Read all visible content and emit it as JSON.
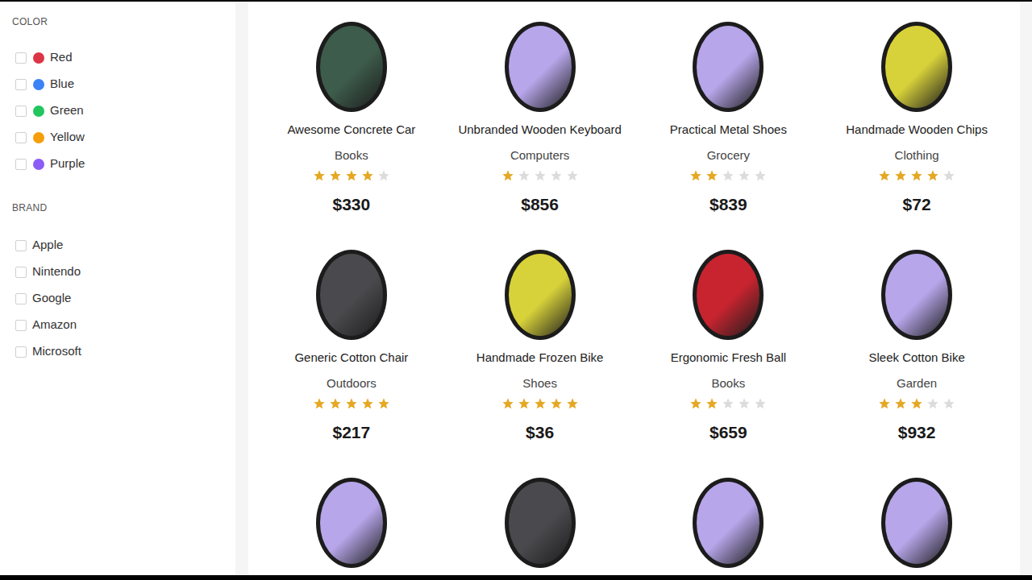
{
  "sidebar": {
    "sections": [
      {
        "title": "COLOR",
        "items": [
          {
            "label": "Red",
            "checked": false,
            "color": "#dc3545"
          },
          {
            "label": "Blue",
            "checked": false,
            "color": "#3b82f6"
          },
          {
            "label": "Green",
            "checked": false,
            "color": "#22c55e"
          },
          {
            "label": "Yellow",
            "checked": false,
            "color": "#f59e0b"
          },
          {
            "label": "Purple",
            "checked": false,
            "color": "#8b5cf6"
          }
        ]
      },
      {
        "title": "BRAND",
        "items": [
          {
            "label": "Apple",
            "checked": false
          },
          {
            "label": "Nintendo",
            "checked": false
          },
          {
            "label": "Google",
            "checked": false
          },
          {
            "label": "Amazon",
            "checked": false
          },
          {
            "label": "Microsoft",
            "checked": false
          }
        ]
      }
    ]
  },
  "products": [
    {
      "name": "Awesome Concrete Car",
      "category": "Books",
      "stars": 4,
      "price": "$330",
      "color": "#3d5c4b"
    },
    {
      "name": "Unbranded Wooden Keyboard",
      "category": "Computers",
      "stars": 1,
      "price": "$856",
      "color": "#b7a6ea"
    },
    {
      "name": "Practical Metal Shoes",
      "category": "Grocery",
      "stars": 2,
      "price": "$839",
      "color": "#b7a6ea"
    },
    {
      "name": "Handmade Wooden Chips",
      "category": "Clothing",
      "stars": 4,
      "price": "$72",
      "color": "#d8d23a"
    },
    {
      "name": "Generic Cotton Chair",
      "category": "Outdoors",
      "stars": 5,
      "price": "$217",
      "color": "#4a4a4e"
    },
    {
      "name": "Handmade Frozen Bike",
      "category": "Shoes",
      "stars": 5,
      "price": "$36",
      "color": "#d8d23a"
    },
    {
      "name": "Ergonomic Fresh Ball",
      "category": "Books",
      "stars": 2,
      "price": "$659",
      "color": "#c8242f"
    },
    {
      "name": "Sleek Cotton Bike",
      "category": "Garden",
      "stars": 3,
      "price": "$932",
      "color": "#b7a6ea"
    },
    {
      "color": "#b7a6ea"
    },
    {
      "color": "#4a4a4e"
    },
    {
      "color": "#b7a6ea"
    },
    {
      "color": "#b7a6ea"
    }
  ]
}
